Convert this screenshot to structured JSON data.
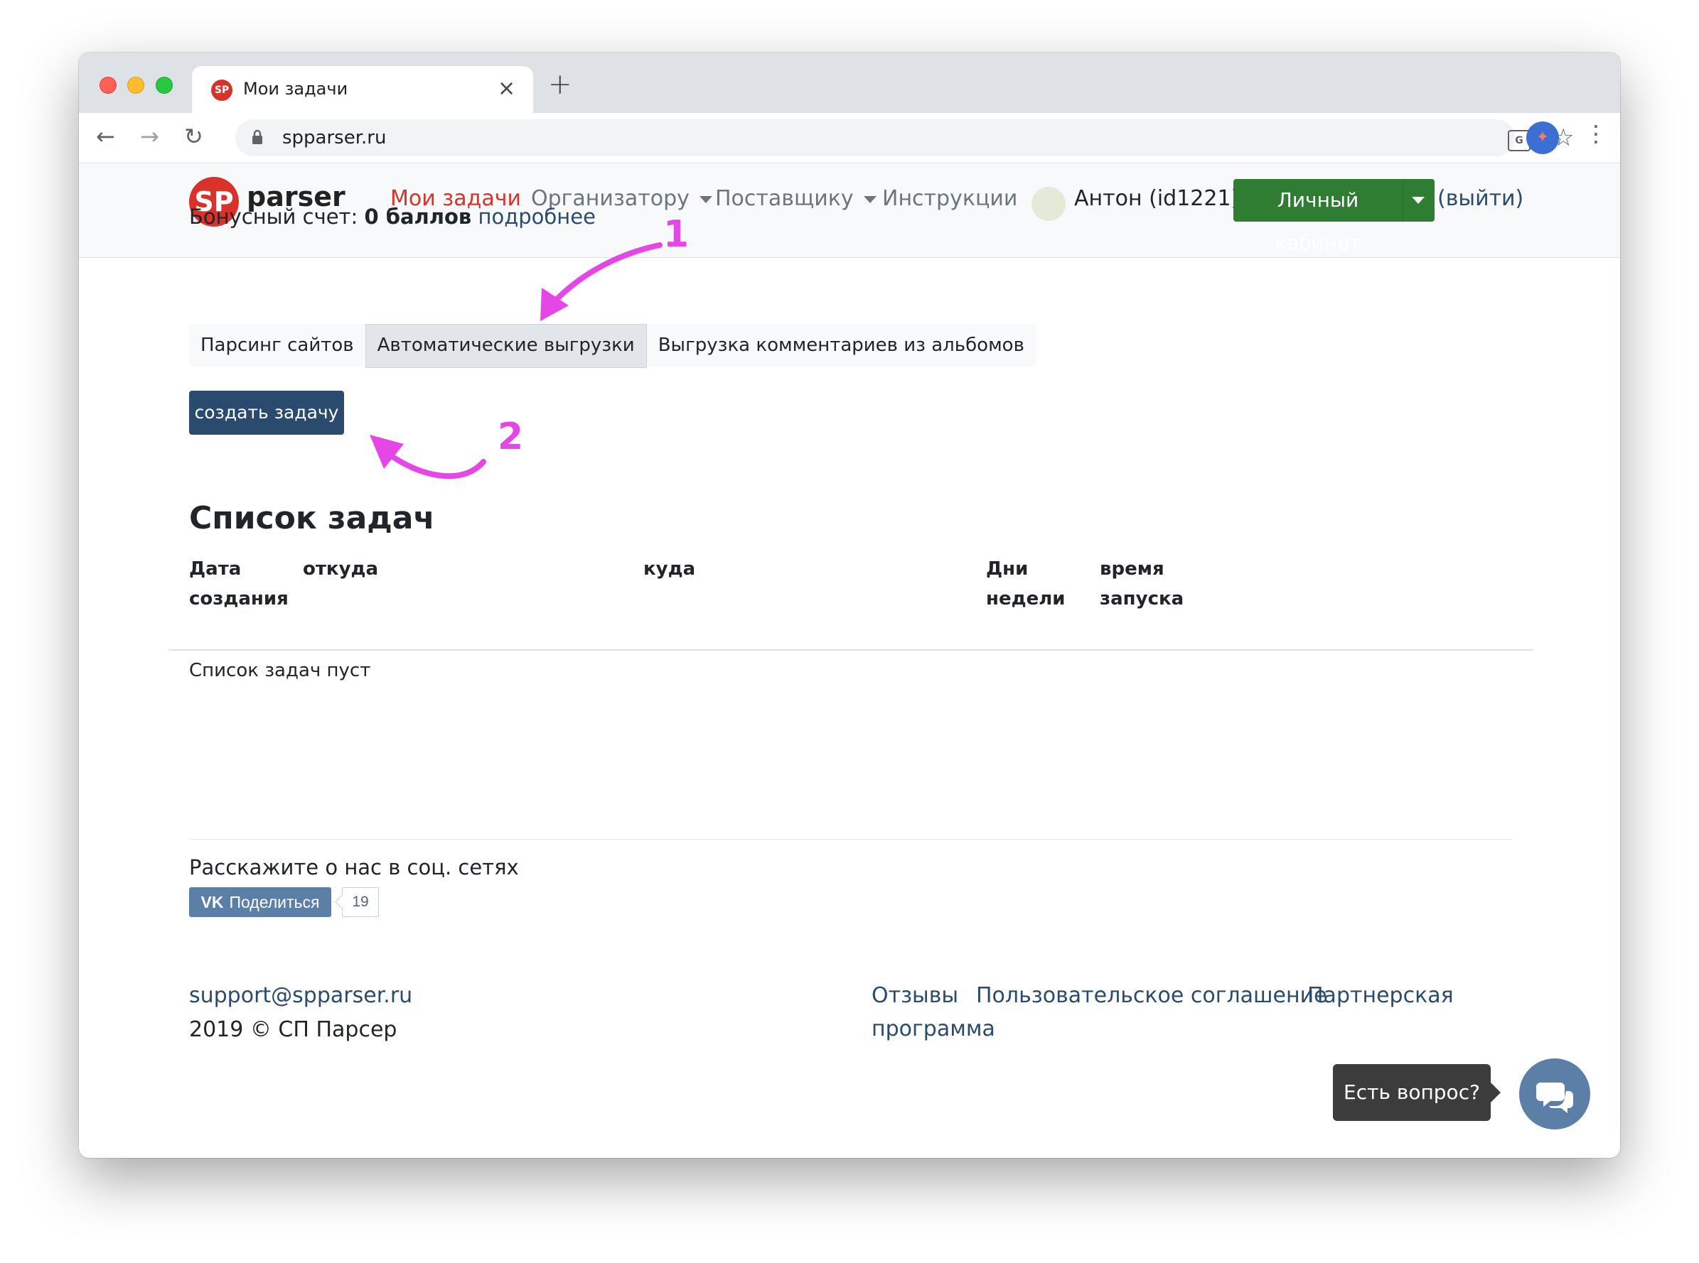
{
  "browser": {
    "tab_title": "Мои задачи",
    "tab_favicon": "SP",
    "close_glyph": "×",
    "new_tab_glyph": "+",
    "url": "spparser.ru",
    "back_glyph": "←",
    "forward_glyph": "→",
    "reload_glyph": "↻",
    "star_glyph": "☆",
    "menu_glyph": "⋮",
    "translate_glyph": "G",
    "profile_glyph": "✦"
  },
  "site": {
    "logo_mark": "SP",
    "logo_text": "parser",
    "nav": {
      "my_tasks": "Мои задачи",
      "organizer": "Организатору",
      "supplier": "Поставщику",
      "instructions": "Инструкции"
    },
    "user_name": "Антон (id1221)!",
    "cabinet_button": "Личный кабинет",
    "logout": "(выйти)"
  },
  "bonus": {
    "label": "Бонусный счет: ",
    "value": "0 баллов",
    "more_link": "подробнее"
  },
  "tabs": [
    "Парсинг сайтов",
    "Автоматические выгрузки",
    "Выгрузка комментариев из альбомов"
  ],
  "active_tab_index": 1,
  "create_button": "создать задачу",
  "task_list": {
    "title": "Список задач",
    "columns": [
      "Дата создания",
      "откуда",
      "куда",
      "Дни недели",
      "время запуска"
    ],
    "empty_message": "Список задач пуст"
  },
  "share": {
    "text": "Расскажите о нас в соц. сетях",
    "vk_logo": "VK",
    "vk_button": "Поделиться",
    "vk_count": "19"
  },
  "footer": {
    "email": "support@spparser.ru",
    "copyright": "2019 © СП Парсер",
    "links": [
      "Отзывы",
      "Пользовательское соглашение",
      "Партнерская",
      "программа"
    ]
  },
  "chat": {
    "bubble_text": "Есть вопрос?"
  },
  "annotations": {
    "first": "1",
    "second": "2",
    "color": "#e547e6"
  }
}
